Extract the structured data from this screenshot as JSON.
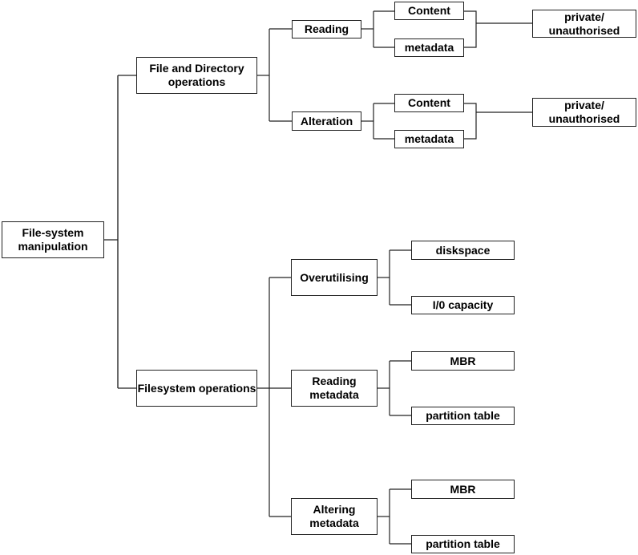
{
  "diagram": {
    "type": "tree",
    "root": "File-system manipulation",
    "nodes": {
      "root": "File-system manipulation",
      "fdo": "File and Directory operations",
      "fso": "Filesystem operations",
      "reading": "Reading",
      "alteration": "Alteration",
      "r_content": "Content",
      "r_metadata": "metadata",
      "a_content": "Content",
      "a_metadata": "metadata",
      "r_private": "private/ unauthorised",
      "a_private": "private/ unauthorised",
      "overutil": "Overutilising",
      "readmeta": "Reading metadata",
      "altermeta": "Altering metadata",
      "diskspace": "diskspace",
      "io": "I/0 capacity",
      "rm_mbr": "MBR",
      "rm_pt": "partition table",
      "am_mbr": "MBR",
      "am_pt": "partition table"
    },
    "edges": [
      [
        "root",
        "fdo"
      ],
      [
        "root",
        "fso"
      ],
      [
        "fdo",
        "reading"
      ],
      [
        "fdo",
        "alteration"
      ],
      [
        "reading",
        "r_content"
      ],
      [
        "reading",
        "r_metadata"
      ],
      [
        "r_content",
        "r_private"
      ],
      [
        "r_metadata",
        "r_private"
      ],
      [
        "alteration",
        "a_content"
      ],
      [
        "alteration",
        "a_metadata"
      ],
      [
        "a_content",
        "a_private"
      ],
      [
        "a_metadata",
        "a_private"
      ],
      [
        "fso",
        "overutil"
      ],
      [
        "fso",
        "readmeta"
      ],
      [
        "fso",
        "altermeta"
      ],
      [
        "overutil",
        "diskspace"
      ],
      [
        "overutil",
        "io"
      ],
      [
        "readmeta",
        "rm_mbr"
      ],
      [
        "readmeta",
        "rm_pt"
      ],
      [
        "altermeta",
        "am_mbr"
      ],
      [
        "altermeta",
        "am_pt"
      ]
    ]
  }
}
